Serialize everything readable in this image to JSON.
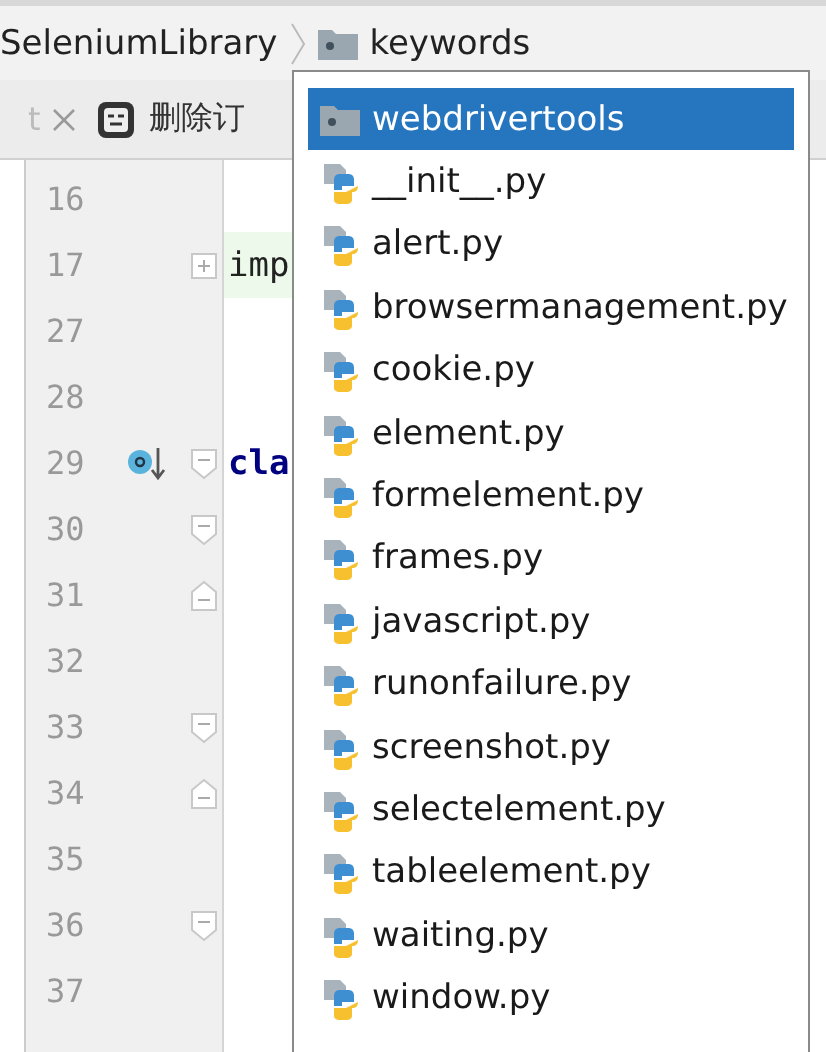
{
  "breadcrumb": [
    {
      "label": "SeleniumLibrary",
      "kind": "text"
    },
    {
      "label": "keywords",
      "kind": "folder"
    }
  ],
  "tabs": [
    {
      "label": "t",
      "kind": "plain"
    },
    {
      "label": "删除订",
      "kind": "robot"
    }
  ],
  "editor": {
    "lines": [
      {
        "number": "16",
        "kind": "plain",
        "gutter_icon": false
      },
      {
        "number": "17",
        "kind": "fold_plus",
        "code": {
          "text": "imp",
          "kind": "import"
        },
        "gutter_icon": false
      },
      {
        "number": "27",
        "kind": "plain",
        "gutter_icon": false
      },
      {
        "number": "28",
        "kind": "plain",
        "gutter_icon": false
      },
      {
        "number": "29",
        "kind": "fold_start",
        "code": {
          "text": "cla",
          "kind": "keyword"
        },
        "gutter_icon": true
      },
      {
        "number": "30",
        "kind": "fold_start",
        "gutter_icon": false
      },
      {
        "number": "31",
        "kind": "fold_end",
        "gutter_icon": false
      },
      {
        "number": "32",
        "kind": "plain",
        "gutter_icon": false
      },
      {
        "number": "33",
        "kind": "fold_start",
        "gutter_icon": false
      },
      {
        "number": "34",
        "kind": "fold_end",
        "gutter_icon": false
      },
      {
        "number": "35",
        "kind": "plain",
        "gutter_icon": false
      },
      {
        "number": "36",
        "kind": "fold_start",
        "gutter_icon": false
      },
      {
        "number": "37",
        "kind": "plain",
        "gutter_icon": false
      }
    ]
  },
  "popup": {
    "items": [
      {
        "label": "webdrivertools",
        "kind": "folder",
        "selected": true
      },
      {
        "label": "__init__.py",
        "kind": "python",
        "selected": false
      },
      {
        "label": "alert.py",
        "kind": "python",
        "selected": false
      },
      {
        "label": "browsermanagement.py",
        "kind": "python",
        "selected": false
      },
      {
        "label": "cookie.py",
        "kind": "python",
        "selected": false
      },
      {
        "label": "element.py",
        "kind": "python",
        "selected": false
      },
      {
        "label": "formelement.py",
        "kind": "python",
        "selected": false
      },
      {
        "label": "frames.py",
        "kind": "python",
        "selected": false
      },
      {
        "label": "javascript.py",
        "kind": "python",
        "selected": false
      },
      {
        "label": "runonfailure.py",
        "kind": "python",
        "selected": false
      },
      {
        "label": "screenshot.py",
        "kind": "python",
        "selected": false
      },
      {
        "label": "selectelement.py",
        "kind": "python",
        "selected": false
      },
      {
        "label": "tableelement.py",
        "kind": "python",
        "selected": false
      },
      {
        "label": "waiting.py",
        "kind": "python",
        "selected": false
      },
      {
        "label": "window.py",
        "kind": "python",
        "selected": false
      }
    ]
  }
}
